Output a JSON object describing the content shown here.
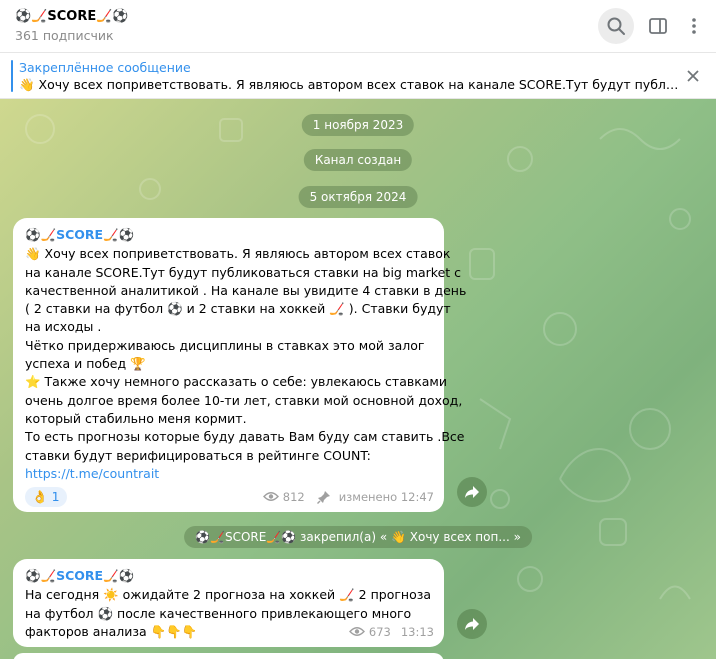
{
  "header": {
    "title": "⚽🏒SCORE🏒⚽",
    "subscribers": "361 подписчик"
  },
  "pinned": {
    "label": "Закреплённое сообщение",
    "text": "👋 Хочу всех поприветствовать. Я являюсь автором всех ставок на канале SCORE.Тут будут публикова..."
  },
  "dates": {
    "d1": "1 ноября 2023",
    "created": "Канал создан",
    "d2": "5 октября 2024"
  },
  "messages": [
    {
      "author": "⚽🏒SCORE🏒⚽",
      "lines": [
        "👋 Хочу всех поприветствовать. Я являюсь автором всех ставок",
        "на канале SCORE.Тут будут публиковаться ставки на big market с",
        "качественной аналитикой . На канале вы увидите 4 ставки в день",
        "( 2 ставки на футбол ⚽ и 2 ставки на хоккей 🏒 ). Ставки будут",
        "на исходы .",
        "Чётко придерживаюсь дисциплины в ставках это мой залог",
        "успеха и побед 🏆",
        "⭐ Также хочу немного рассказать о себе: увлекаюсь ставками",
        "очень долгое время более 10-ти лет, ставки мой основной доход,",
        "который стабильно меня кормит.",
        "То есть прогнозы которые буду давать Вам буду сам ставить .Все",
        "ставки будут верифицироваться  в рейтинге COUNT:"
      ],
      "link": "https://t.me/countrait",
      "reaction_emoji": "👌",
      "reaction_count": "1",
      "views": "812",
      "edited": "изменено 12:47"
    },
    {
      "author": "⚽🏒SCORE🏒⚽",
      "lines": [
        "На сегодня ☀️ ожидайте 2 прогноза на хоккей 🏒 2  прогноза",
        "на футбол ⚽ после качественного привлекающего много",
        "факторов анализа 👇👇👇"
      ],
      "views": "673",
      "time": "13:13"
    }
  ],
  "service": "⚽🏒SCORE🏒⚽ закрепил(а) « 👋 Хочу всех поп... »",
  "colors": {
    "accent": "#3390ec",
    "pill_bg": "rgba(86,120,74,0.45)"
  },
  "icons": [
    "search-icon",
    "sidebar-toggle-icon",
    "more-vertical-icon",
    "close-icon",
    "eye-icon",
    "pin-icon",
    "share-arrow-icon"
  ]
}
